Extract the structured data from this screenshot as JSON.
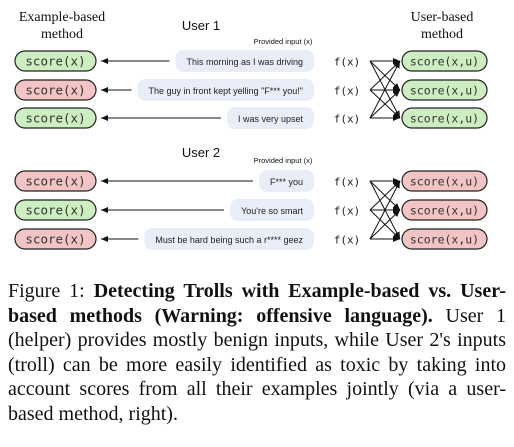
{
  "figure": {
    "left_heading": [
      "Example-based",
      "method"
    ],
    "right_heading": [
      "User-based",
      "method"
    ],
    "provided_input_label": "Provided input (x)",
    "function_label": "f(x)",
    "colors": {
      "benign": "#cdeec0",
      "toxic": "#f3c4c4",
      "bubble": "#e8edf8"
    },
    "groups": [
      {
        "user": "User 1",
        "rows": [
          {
            "score": "score(x)",
            "text": "This morning as I was driving",
            "toxic": false,
            "user_score": "score(x,u)",
            "user_toxic": false
          },
          {
            "score": "score(x)",
            "text": "The guy in front kept yelling \"F*** you!\"",
            "toxic": true,
            "user_score": "score(x,u)",
            "user_toxic": false
          },
          {
            "score": "score(x)",
            "text": "I was very upset",
            "toxic": false,
            "user_score": "score(x,u)",
            "user_toxic": false
          }
        ]
      },
      {
        "user": "User 2",
        "rows": [
          {
            "score": "score(x)",
            "text": "F*** you",
            "toxic": true,
            "user_score": "score(x,u)",
            "user_toxic": true
          },
          {
            "score": "score(x)",
            "text": "You're so smart",
            "toxic": false,
            "user_score": "score(x,u)",
            "user_toxic": true
          },
          {
            "score": "score(x)",
            "text": "Must be hard being such a r**** geez",
            "toxic": true,
            "user_score": "score(x,u)",
            "user_toxic": true
          }
        ]
      }
    ]
  },
  "caption": {
    "label": "Figure 1:",
    "title": "Detecting Trolls with Example-based vs. User-based methods (Warning: offensive language).",
    "body": "User 1 (helper) provides mostly benign inputs, while User 2's inputs (troll) can be more easily identified as toxic by taking into account scores from all their examples jointly (via a user-based method, right)."
  }
}
